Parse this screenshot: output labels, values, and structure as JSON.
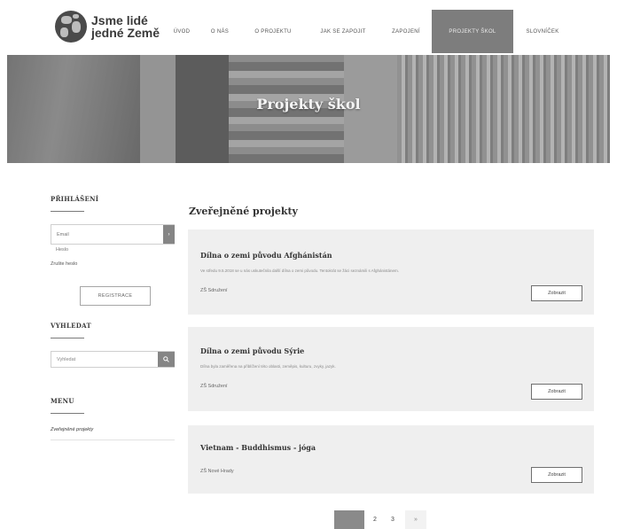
{
  "header": {
    "logo_line1": "Jsme lidé",
    "logo_line2": "jedné Země",
    "nav": [
      {
        "label": "ÚVOD",
        "active": false
      },
      {
        "label": "O NÁS",
        "active": false
      },
      {
        "label": "O PROJEKTU",
        "active": false
      },
      {
        "label": "JAK SE ZAPOJIT",
        "active": false
      },
      {
        "label": "ZAPOJENÍ",
        "active": false
      },
      {
        "label": "PROJEKTY ŠKOL",
        "active": true
      },
      {
        "label": "SLOVNÍČEK",
        "active": false
      }
    ]
  },
  "hero": {
    "title": "Projekty škol"
  },
  "sidebar": {
    "login_heading": "PŘIHLÁŠENÍ",
    "email_placeholder": "Email",
    "login_button_icon": "arrow-right-icon",
    "password_placeholder": "Heslo",
    "forgot_link": "Zrušte heslo",
    "register_button": "REGISTRACE",
    "search_heading": "VYHLEDAT",
    "search_placeholder": "Vyhledat",
    "search_button_icon": "search-icon",
    "menu_heading": "MENU",
    "menu_link": "Zveřejněné projekty"
  },
  "main": {
    "title": "Zveřejněné projekty",
    "cards": [
      {
        "title": "Dílna o zemi původu Afghánistán",
        "desc": "Ve středu 9.5.2018 se u nás uskutečnila další dílna o zemi původu. Tentokrát se žáci seznámili s Afghánistánem.",
        "school": "ZŠ Sdružení",
        "button": "Zobrazit"
      },
      {
        "title": "Dílna o zemi původu Sýrie",
        "desc": "Dílna byla zaměřena na přiblížení této oblasti, zeměpis, kulturu, zvyky, jazyk.",
        "school": "ZŠ Sdružení",
        "button": "Zobrazit"
      },
      {
        "title": "Vietnam - Buddhismus - jóga",
        "desc": "",
        "school": "ZŠ Nové Hrady",
        "button": "Zobrazit"
      }
    ]
  },
  "pagination": {
    "pages": [
      "1",
      "2",
      "3"
    ],
    "current": "1",
    "next": "»"
  }
}
